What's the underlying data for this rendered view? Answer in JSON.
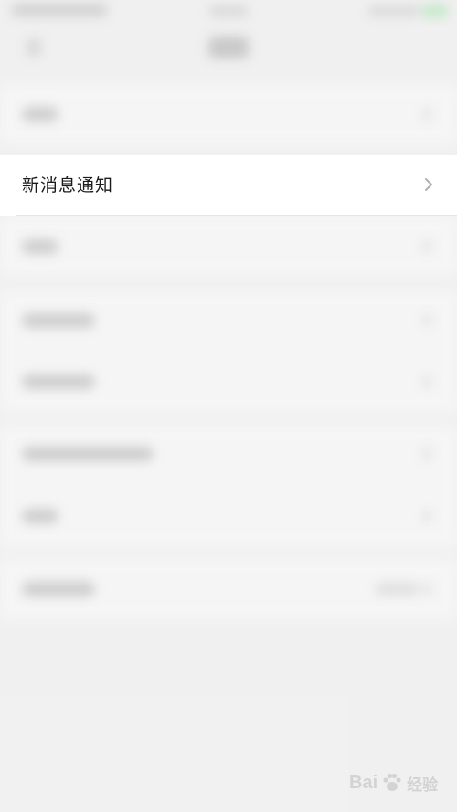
{
  "settings_screen": {
    "highlighted_item": {
      "label": "新消息通知",
      "icon": "chevron-right-icon"
    }
  },
  "watermark": {
    "brand_latin": "Bai",
    "brand_suffix": "经验",
    "icon": "paw-icon"
  },
  "colors": {
    "background": "#ededed",
    "row_background": "#ffffff",
    "label_text": "#1b1b1b",
    "chevron": "#b0b0b0",
    "battery_green": "#5bd36b"
  }
}
